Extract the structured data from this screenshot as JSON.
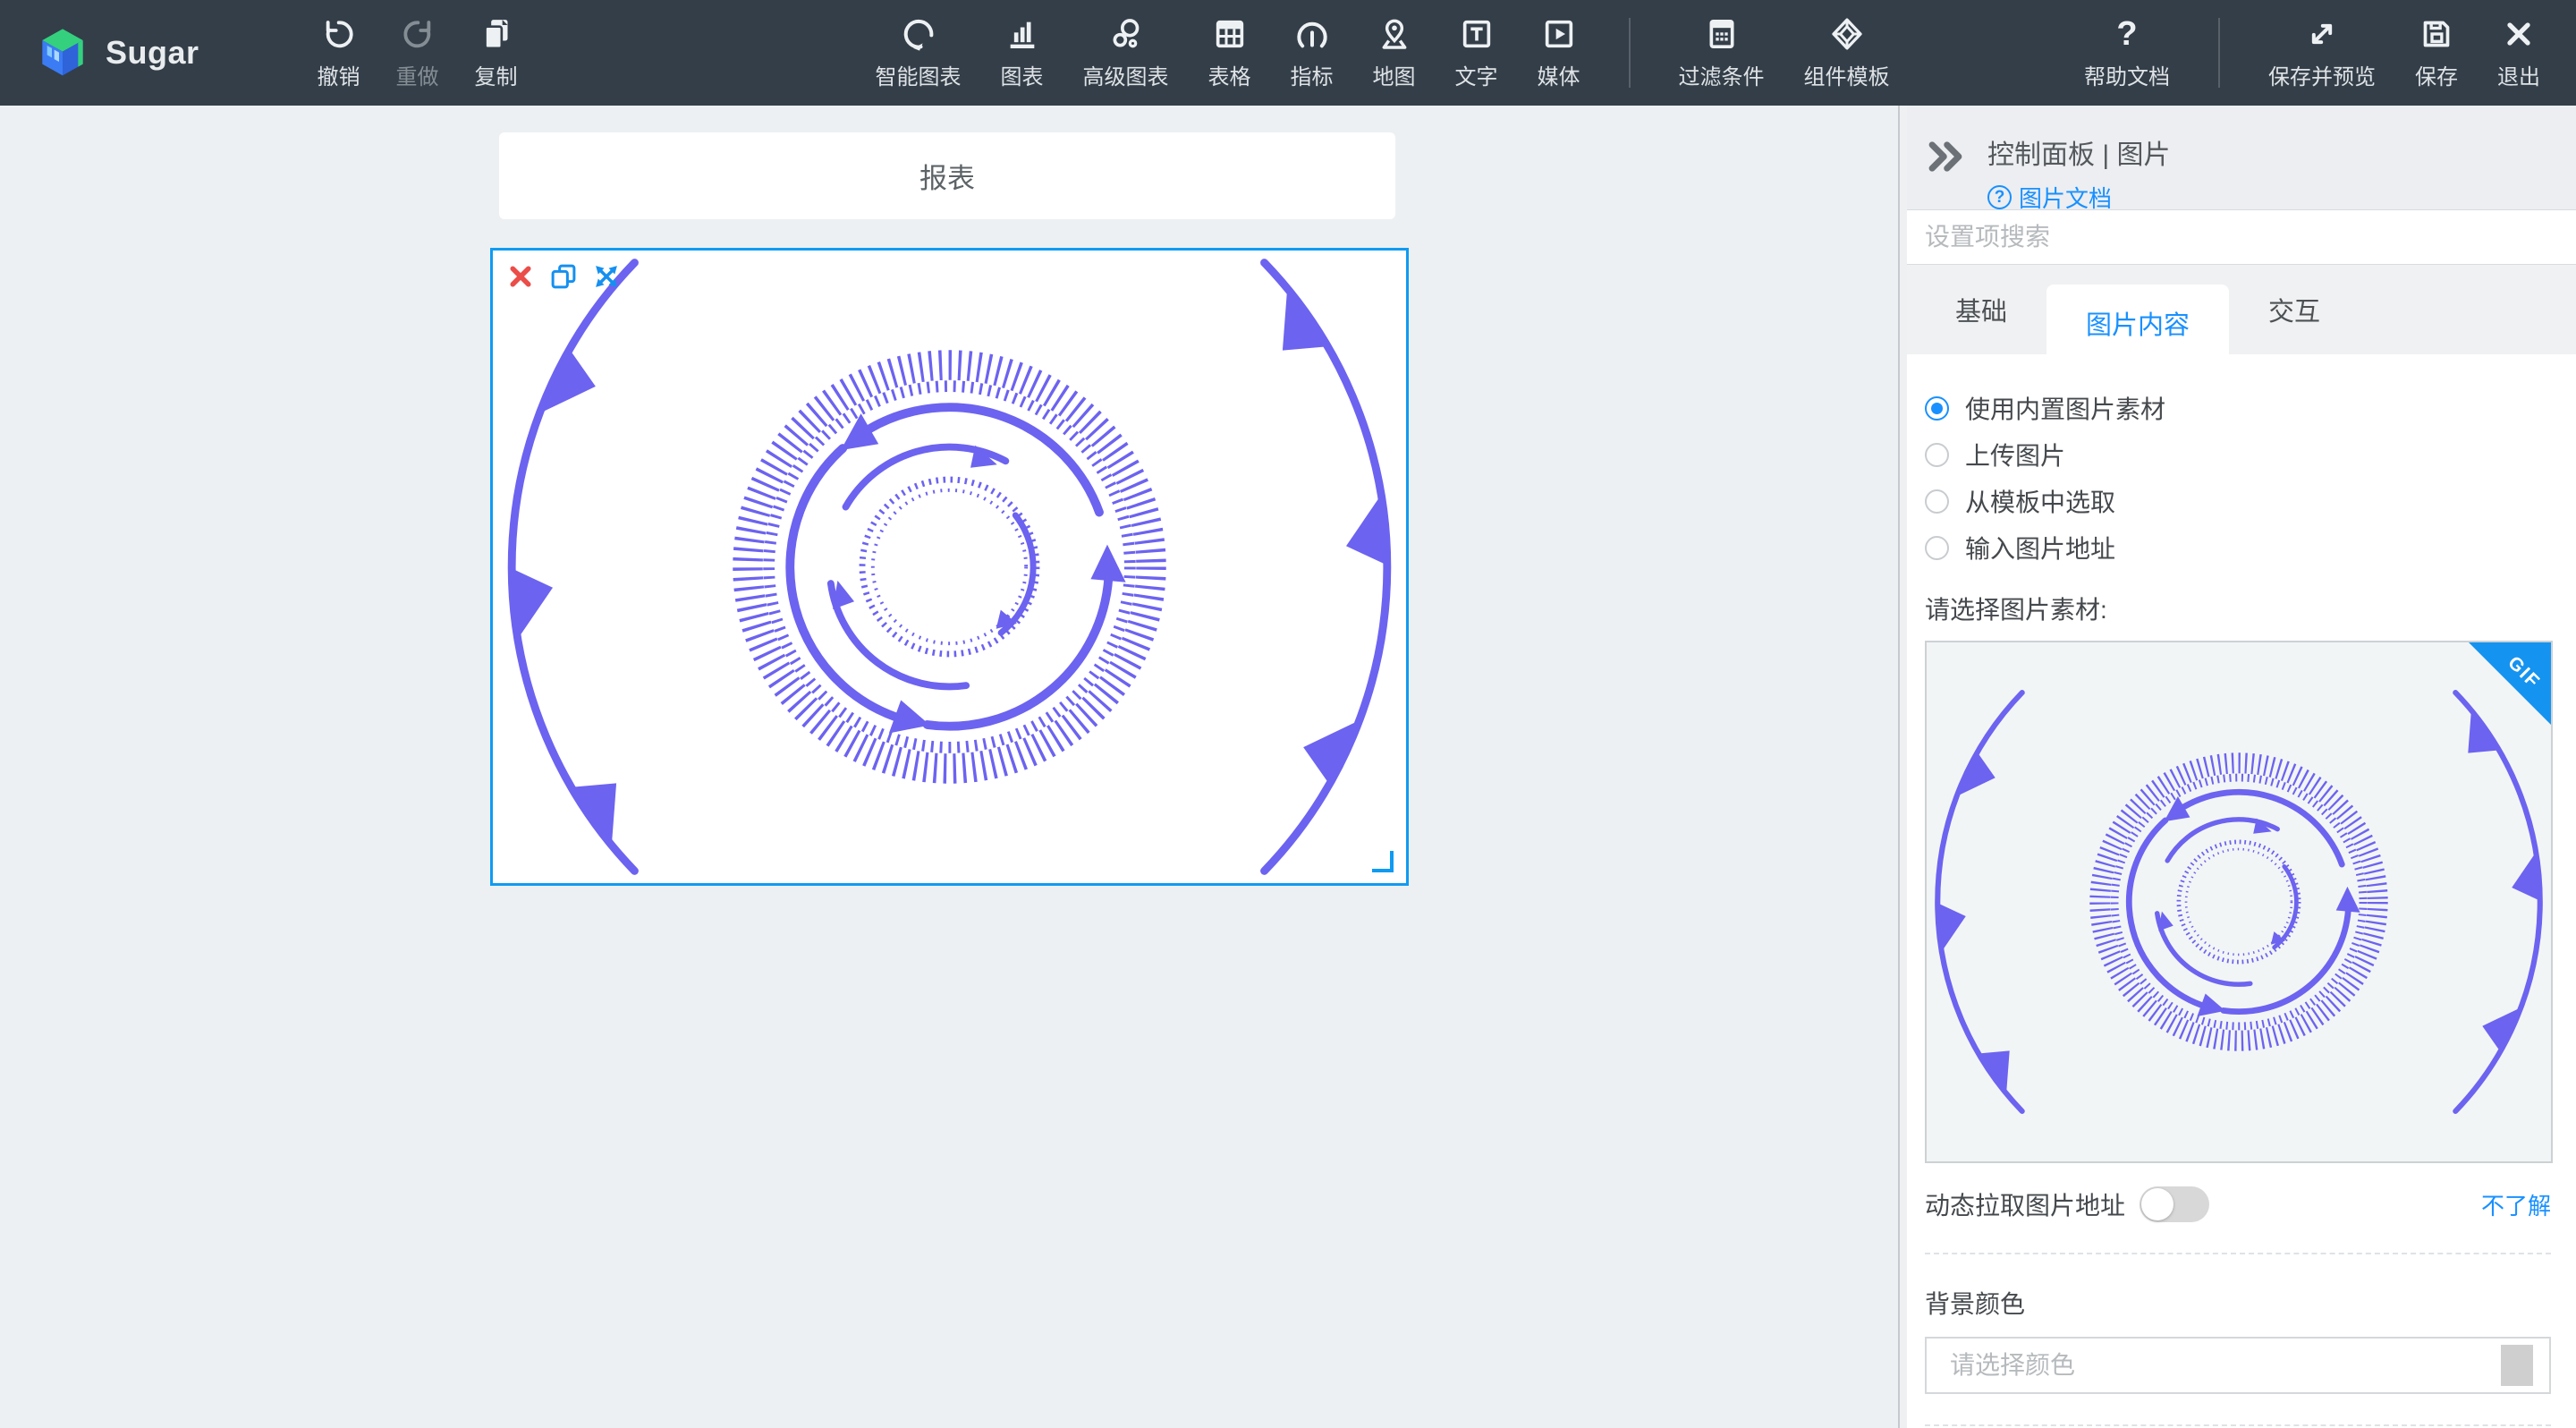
{
  "brand": {
    "name": "Sugar"
  },
  "toolbar": {
    "undo": "撤销",
    "redo": "重做",
    "copy": "复制",
    "smart_chart": "智能图表",
    "chart": "图表",
    "advanced_chart": "高级图表",
    "table": "表格",
    "indicator": "指标",
    "map": "地图",
    "text": "文字",
    "media": "媒体",
    "filter": "过滤条件",
    "component_template": "组件模板",
    "help": "帮助文档",
    "save_preview": "保存并预览",
    "save": "保存",
    "exit": "退出"
  },
  "canvas": {
    "report_title": "报表"
  },
  "panel": {
    "title": "控制面板 | 图片",
    "doc_link": "图片文档",
    "search_placeholder": "设置项搜索",
    "tabs": {
      "basic": "基础",
      "image_content": "图片内容",
      "interaction": "交互",
      "active": "图片内容"
    },
    "source_options": {
      "builtin": "使用内置图片素材",
      "upload": "上传图片",
      "from_template": "从模板中选取",
      "url": "输入图片地址",
      "selected": "使用内置图片素材"
    },
    "select_material_label": "请选择图片素材:",
    "gif_badge": "GIF",
    "dynamic_url": {
      "label": "动态拉取图片地址",
      "state": "off"
    },
    "help_link": "不了解",
    "bg_color_label": "背景颜色",
    "color_placeholder": "请选择颜色"
  },
  "icons": {
    "question_glyph": "?",
    "help_glyph": "?"
  },
  "colors": {
    "toolbar_bg": "#333e48",
    "accent": "#1890ff",
    "selection": "#0f9bf2",
    "decor": "#6c63f0",
    "gif_badge": "#1593f0",
    "delete": "#eb4d48"
  }
}
